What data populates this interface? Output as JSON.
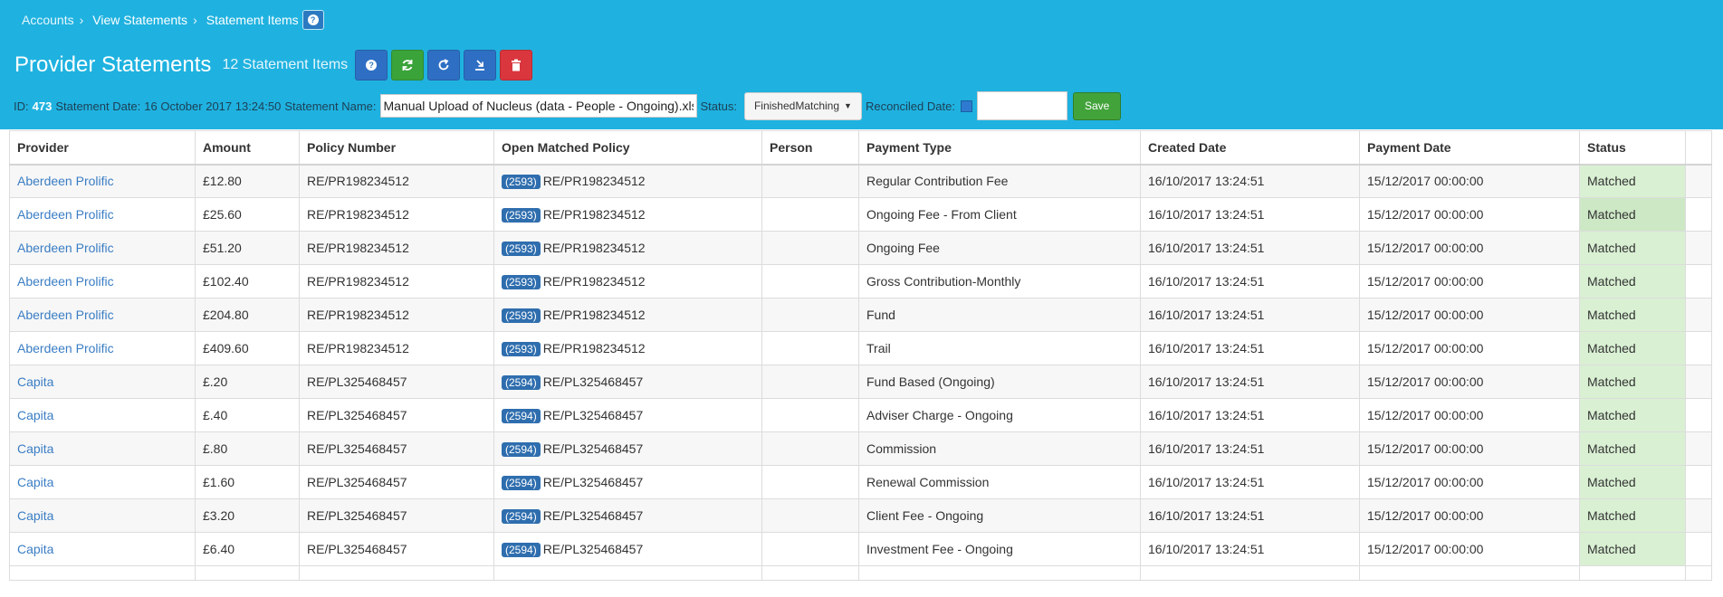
{
  "breadcrumb": {
    "items": [
      "Accounts",
      "View Statements",
      "Statement Items"
    ],
    "sep": "›"
  },
  "header": {
    "title": "Provider Statements",
    "subtitle": "12 Statement Items"
  },
  "toolbar": {
    "icons": [
      "help-icon",
      "sync-icon",
      "refresh-icon",
      "download-icon",
      "trash-icon"
    ]
  },
  "info": {
    "id_label": "ID:",
    "id_value": "473",
    "date_label": "Statement Date:",
    "date_value": "16 October 2017 13:24:50",
    "name_label": "Statement Name:",
    "name_value": "Manual Upload of Nucleus (data - People - Ongoing).xlsx",
    "status_label": "Status:",
    "status_value": "FinishedMatching",
    "reconciled_label": "Reconciled Date:",
    "reconciled_value": "",
    "save_label": "Save"
  },
  "colors": {
    "header_bg": "#1fb2e0",
    "link": "#3a7dc4",
    "matched_bg": "#d9f0d3",
    "badge": "#2f6eae"
  },
  "table": {
    "columns": [
      "Provider",
      "Amount",
      "Policy Number",
      "Open Matched Policy",
      "Person",
      "Payment Type",
      "Created Date",
      "Payment Date",
      "Status"
    ],
    "rows": [
      {
        "provider": "Aberdeen Prolific",
        "amount": "£12.80",
        "policy": "RE/PR198234512",
        "badge": "(2593)",
        "matched": "RE/PR198234512",
        "person": "",
        "type": "Regular Contribution Fee",
        "created": "16/10/2017 13:24:51",
        "payment": "15/12/2017 00:00:00",
        "status": "Matched"
      },
      {
        "provider": "Aberdeen Prolific",
        "amount": "£25.60",
        "policy": "RE/PR198234512",
        "badge": "(2593)",
        "matched": "RE/PR198234512",
        "person": "",
        "type": "Ongoing Fee - From Client",
        "created": "16/10/2017 13:24:51",
        "payment": "15/12/2017 00:00:00",
        "status": "Matched"
      },
      {
        "provider": "Aberdeen Prolific",
        "amount": "£51.20",
        "policy": "RE/PR198234512",
        "badge": "(2593)",
        "matched": "RE/PR198234512",
        "person": "",
        "type": "Ongoing Fee",
        "created": "16/10/2017 13:24:51",
        "payment": "15/12/2017 00:00:00",
        "status": "Matched"
      },
      {
        "provider": "Aberdeen Prolific",
        "amount": "£102.40",
        "policy": "RE/PR198234512",
        "badge": "(2593)",
        "matched": "RE/PR198234512",
        "person": "",
        "type": "Gross Contribution-Monthly",
        "created": "16/10/2017 13:24:51",
        "payment": "15/12/2017 00:00:00",
        "status": "Matched"
      },
      {
        "provider": "Aberdeen Prolific",
        "amount": "£204.80",
        "policy": "RE/PR198234512",
        "badge": "(2593)",
        "matched": "RE/PR198234512",
        "person": "",
        "type": "Fund",
        "created": "16/10/2017 13:24:51",
        "payment": "15/12/2017 00:00:00",
        "status": "Matched"
      },
      {
        "provider": "Aberdeen Prolific",
        "amount": "£409.60",
        "policy": "RE/PR198234512",
        "badge": "(2593)",
        "matched": "RE/PR198234512",
        "person": "",
        "type": "Trail",
        "created": "16/10/2017 13:24:51",
        "payment": "15/12/2017 00:00:00",
        "status": "Matched"
      },
      {
        "provider": "Capita",
        "amount": "£.20",
        "policy": "RE/PL325468457",
        "badge": "(2594)",
        "matched": "RE/PL325468457",
        "person": "",
        "type": "Fund Based (Ongoing)",
        "created": "16/10/2017 13:24:51",
        "payment": "15/12/2017 00:00:00",
        "status": "Matched"
      },
      {
        "provider": "Capita",
        "amount": "£.40",
        "policy": "RE/PL325468457",
        "badge": "(2594)",
        "matched": "RE/PL325468457",
        "person": "",
        "type": "Adviser Charge - Ongoing",
        "created": "16/10/2017 13:24:51",
        "payment": "15/12/2017 00:00:00",
        "status": "Matched"
      },
      {
        "provider": "Capita",
        "amount": "£.80",
        "policy": "RE/PL325468457",
        "badge": "(2594)",
        "matched": "RE/PL325468457",
        "person": "",
        "type": "Commission",
        "created": "16/10/2017 13:24:51",
        "payment": "15/12/2017 00:00:00",
        "status": "Matched"
      },
      {
        "provider": "Capita",
        "amount": "£1.60",
        "policy": "RE/PL325468457",
        "badge": "(2594)",
        "matched": "RE/PL325468457",
        "person": "",
        "type": "Renewal Commission",
        "created": "16/10/2017 13:24:51",
        "payment": "15/12/2017 00:00:00",
        "status": "Matched"
      },
      {
        "provider": "Capita",
        "amount": "£3.20",
        "policy": "RE/PL325468457",
        "badge": "(2594)",
        "matched": "RE/PL325468457",
        "person": "",
        "type": "Client Fee - Ongoing",
        "created": "16/10/2017 13:24:51",
        "payment": "15/12/2017 00:00:00",
        "status": "Matched"
      },
      {
        "provider": "Capita",
        "amount": "£6.40",
        "policy": "RE/PL325468457",
        "badge": "(2594)",
        "matched": "RE/PL325468457",
        "person": "",
        "type": "Investment Fee - Ongoing",
        "created": "16/10/2017 13:24:51",
        "payment": "15/12/2017 00:00:00",
        "status": "Matched"
      }
    ]
  }
}
